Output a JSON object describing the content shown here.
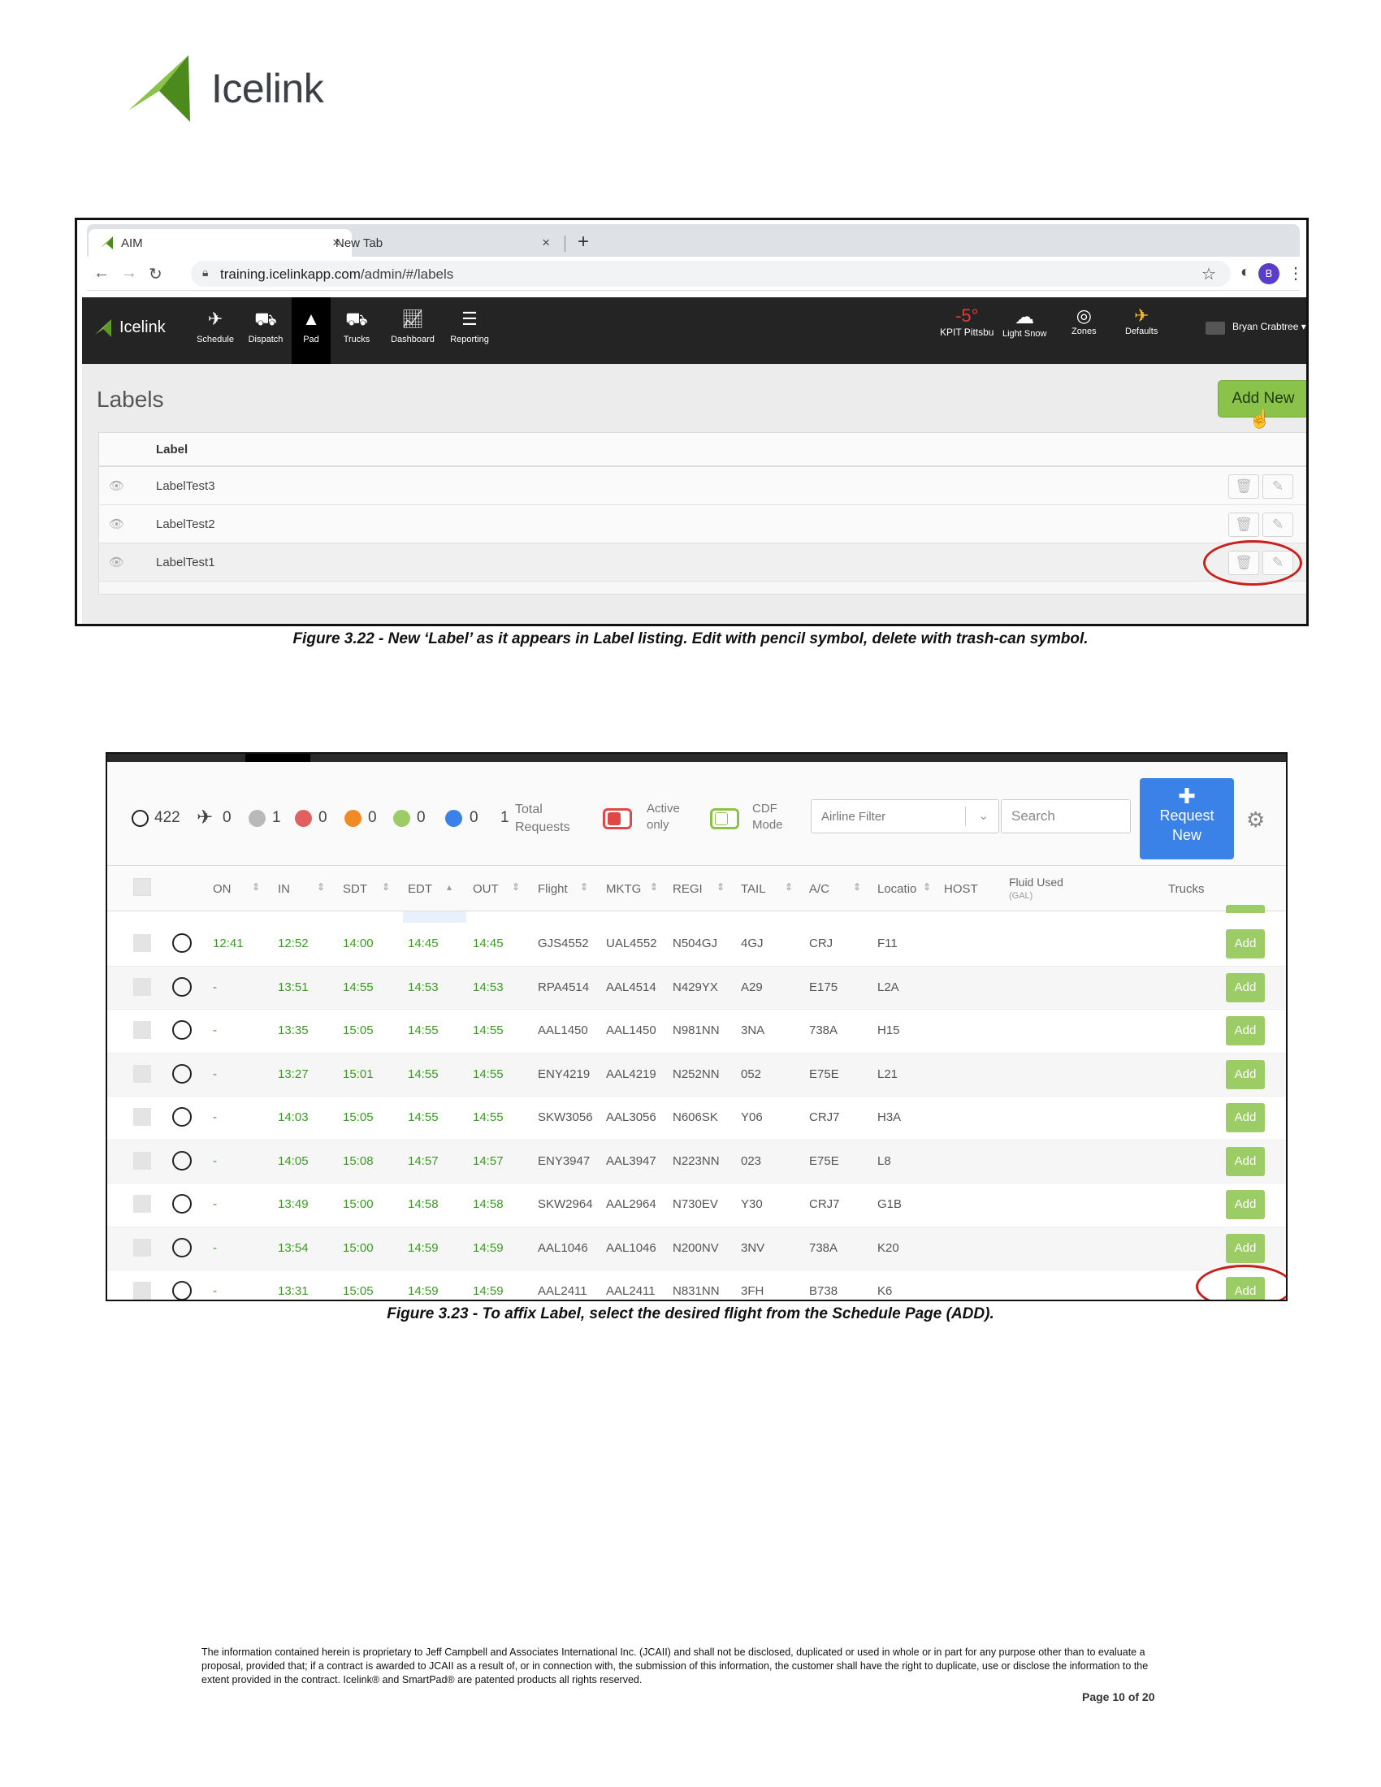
{
  "doc": {
    "logo_text": "Icelink",
    "caption1": "Figure 3.22 - New ‘Label’ as it appears in Label listing. Edit with pencil symbol, delete with trash-can symbol.",
    "caption2": "Figure 3.23 - To affix Label, select the desired flight from the Schedule Page (ADD).",
    "footer": "The information contained herein is proprietary to Jeff Campbell and Associates International Inc. (JCAII) and shall not be disclosed, duplicated or used in whole or in part for any purpose other than to evaluate a proposal, provided that; if a contract is awarded to JCAII as a result of, or in connection with, the submission of this information, the customer shall have the right to duplicate, use or disclose the information to the extent provided in the contract. Icelink® and SmartPad® are patented products all rights reserved.",
    "page_number": "Page 10 of 20",
    "brand_color": "#8bc34a"
  },
  "browser": {
    "tabs": [
      {
        "title": "AIM",
        "close": "×"
      },
      {
        "title": "New Tab",
        "close": "×"
      }
    ],
    "new_tab": "+",
    "url_host": "training.icelinkapp.com",
    "url_path": "/admin/#/labels",
    "profile_initial": "B"
  },
  "app": {
    "brand": "Icelink",
    "nav": [
      {
        "label": "Schedule",
        "icon": "schedule-icon"
      },
      {
        "label": "Dispatch",
        "icon": "dispatch-icon"
      },
      {
        "label": "Pad",
        "icon": "pad-icon"
      },
      {
        "label": "Trucks",
        "icon": "truck-icon"
      },
      {
        "label": "Dashboard",
        "icon": "dashboard-icon"
      },
      {
        "label": "Reporting",
        "icon": "reporting-icon"
      }
    ],
    "temperature": "-5°",
    "station": "KPIT Pittsbu",
    "weather": "Light Snow",
    "zones": "Zones",
    "defaults": "Defaults",
    "user": "Bryan Crabtree"
  },
  "labels_page": {
    "title": "Labels",
    "add_new": "Add New",
    "column_header": "Label",
    "rows": [
      "LabelTest3",
      "LabelTest2",
      "LabelTest1"
    ],
    "delete_icon": "trash-icon",
    "edit_icon": "pencil-icon"
  },
  "schedule": {
    "counts": {
      "total": "422",
      "flights": "0",
      "gray": "1",
      "red": "0",
      "orange": "0",
      "green": "0",
      "blue": "0",
      "requests": "1"
    },
    "status_colors": {
      "gray": "#b9b9b9",
      "red": "#e06060",
      "orange": "#f08a24",
      "green": "#9ccc65",
      "blue": "#3a82e8"
    },
    "total_requests_line1": "Total",
    "total_requests_line2": "Requests",
    "active_only_line1": "Active",
    "active_only_line2": "only",
    "cdf_mode_line1": "CDF",
    "cdf_mode_line2": "Mode",
    "airline_filter_placeholder": "Airline Filter",
    "search_placeholder": "Search",
    "request_new_line1": "Request",
    "request_new_line2": "New",
    "columns": {
      "on": "ON",
      "in": "IN",
      "sdt": "SDT",
      "edt": "EDT",
      "out": "OUT",
      "flight": "Flight",
      "mktg": "MKTG",
      "regi": "REGI",
      "tail": "TAIL",
      "ac": "A/C",
      "location": "Locatio",
      "host": "HOST",
      "fluid": "Fluid Used",
      "fluid_unit": "(GAL)",
      "trucks": "Trucks"
    },
    "add_label": "Add",
    "rows": [
      {
        "on": "12:41",
        "in": "12:52",
        "sdt": "14:00",
        "edt": "14:45",
        "out": "14:45",
        "flight": "GJS4552",
        "mktg": "UAL4552",
        "regi": "N504GJ",
        "tail": "4GJ",
        "ac": "CRJ",
        "loc": "F11"
      },
      {
        "on": "-",
        "in": "13:51",
        "sdt": "14:55",
        "edt": "14:53",
        "out": "14:53",
        "flight": "RPA4514",
        "mktg": "AAL4514",
        "regi": "N429YX",
        "tail": "A29",
        "ac": "E175",
        "loc": "L2A"
      },
      {
        "on": "-",
        "in": "13:35",
        "sdt": "15:05",
        "edt": "14:55",
        "out": "14:55",
        "flight": "AAL1450",
        "mktg": "AAL1450",
        "regi": "N981NN",
        "tail": "3NA",
        "ac": "738A",
        "loc": "H15"
      },
      {
        "on": "-",
        "in": "13:27",
        "sdt": "15:01",
        "edt": "14:55",
        "out": "14:55",
        "flight": "ENY4219",
        "mktg": "AAL4219",
        "regi": "N252NN",
        "tail": "052",
        "ac": "E75E",
        "loc": "L21"
      },
      {
        "on": "-",
        "in": "14:03",
        "sdt": "15:05",
        "edt": "14:55",
        "out": "14:55",
        "flight": "SKW3056",
        "mktg": "AAL3056",
        "regi": "N606SK",
        "tail": "Y06",
        "ac": "CRJ7",
        "loc": "H3A"
      },
      {
        "on": "-",
        "in": "14:05",
        "sdt": "15:08",
        "edt": "14:57",
        "out": "14:57",
        "flight": "ENY3947",
        "mktg": "AAL3947",
        "regi": "N223NN",
        "tail": "023",
        "ac": "E75E",
        "loc": "L8"
      },
      {
        "on": "-",
        "in": "13:49",
        "sdt": "15:00",
        "edt": "14:58",
        "out": "14:58",
        "flight": "SKW2964",
        "mktg": "AAL2964",
        "regi": "N730EV",
        "tail": "Y30",
        "ac": "CRJ7",
        "loc": "G1B"
      },
      {
        "on": "-",
        "in": "13:54",
        "sdt": "15:00",
        "edt": "14:59",
        "out": "14:59",
        "flight": "AAL1046",
        "mktg": "AAL1046",
        "regi": "N200NV",
        "tail": "3NV",
        "ac": "738A",
        "loc": "K20"
      },
      {
        "on": "-",
        "in": "13:31",
        "sdt": "15:05",
        "edt": "14:59",
        "out": "14:59",
        "flight": "AAL2411",
        "mktg": "AAL2411",
        "regi": "N831NN",
        "tail": "3FH",
        "ac": "B738",
        "loc": "K6"
      }
    ]
  }
}
